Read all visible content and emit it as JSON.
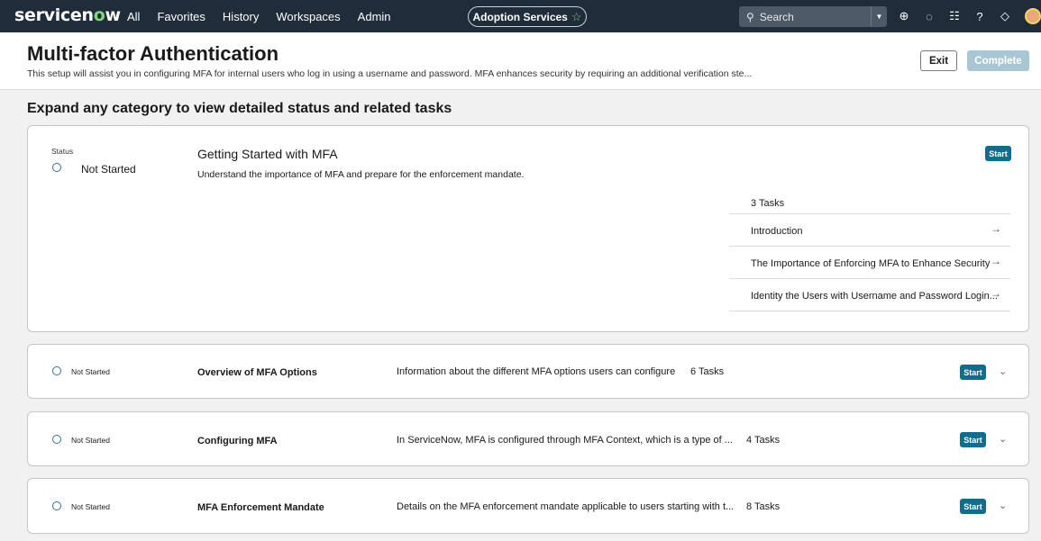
{
  "nav": {
    "logo_pre": "servicen",
    "logo_o": "o",
    "logo_post": "w",
    "items": [
      "All",
      "Favorites",
      "History",
      "Workspaces",
      "Admin"
    ],
    "app_pill": "Adoption Services",
    "search_placeholder": "Search",
    "icons": [
      "globe-icon",
      "chat-icon",
      "list-icon",
      "help-icon",
      "bell-icon"
    ]
  },
  "header": {
    "title": "Multi-factor Authentication",
    "description": "This setup will assist you in configuring MFA for internal users who log in using a username and password. MFA enhances security by requiring an additional verification ste...",
    "exit_label": "Exit",
    "complete_label": "Complete"
  },
  "subheading": "Expand any category to view detailed status and related tasks",
  "expanded": {
    "status_label": "Status",
    "status": "Not Started",
    "title": "Getting Started with MFA",
    "description": "Understand the importance of MFA and prepare for the enforcement mandate.",
    "start_label": "Start",
    "task_count": "3 Tasks",
    "tasks": [
      "Introduction",
      "The Importance of Enforcing MFA to Enhance Security",
      "Identity the Users with Username and Password Login..."
    ]
  },
  "categories": [
    {
      "status": "Not Started",
      "title": "Overview of MFA Options",
      "description": "Information about the different MFA options users can configure",
      "count": "6 Tasks",
      "start_label": "Start"
    },
    {
      "status": "Not Started",
      "title": "Configuring MFA",
      "description": "In ServiceNow, MFA is configured through MFA Context, which is a type of ...",
      "count": "4 Tasks",
      "start_label": "Start"
    },
    {
      "status": "Not Started",
      "title": "MFA Enforcement Mandate",
      "description": "Details on the MFA enforcement mandate applicable to users starting with t...",
      "count": "8 Tasks",
      "start_label": "Start"
    }
  ]
}
